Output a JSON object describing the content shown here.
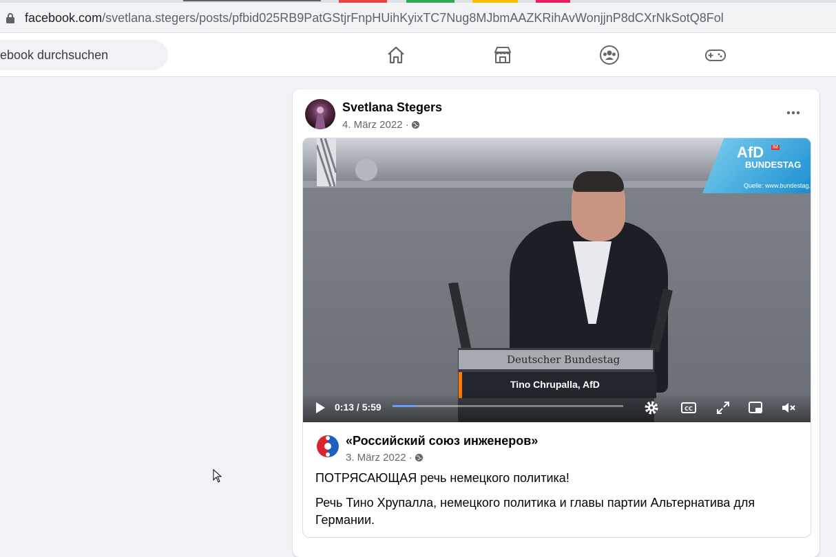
{
  "browser": {
    "url_domain": "facebook.com",
    "url_path": "/svetlana.stegers/posts/pfbid025RB9PatGStjrFnpHUihKyixTC7Nug8MJbmAAZKRihAvWonjjnP8dCXrNkSotQ8Fol",
    "tab_colors": [
      "#e8453c",
      "#34a853",
      "#fbbc05",
      "#e91e63"
    ]
  },
  "search": {
    "placeholder": "ebook durchsuchen"
  },
  "nav": {
    "icons": [
      "home-icon",
      "marketplace-icon",
      "groups-icon",
      "gaming-icon"
    ]
  },
  "post": {
    "author": "Svetlana Stegers",
    "date": "4. März 2022 ·",
    "audience_icon": "globe-icon"
  },
  "video": {
    "plate_title": "Deutscher Bundestag",
    "lower_third": "Tino Chrupalla, AfD",
    "badge_logo": "AfD",
    "badge_im": "IM",
    "badge_bundestag": "BUNDESTAG",
    "badge_source": "Quelle: www.bundestag.de",
    "time": "0:13 / 5:59",
    "progress": 0.1,
    "accent": "#ff7a00"
  },
  "shared": {
    "author": "«Российский союз инженеров»",
    "date": "3. März 2022 ·",
    "headline": "ПОТРЯСАЮЩАЯ речь немецкого политика!",
    "body": "Речь Тино Хрупалла, немецкого политика и главы партии Альтернатива для Германии."
  }
}
